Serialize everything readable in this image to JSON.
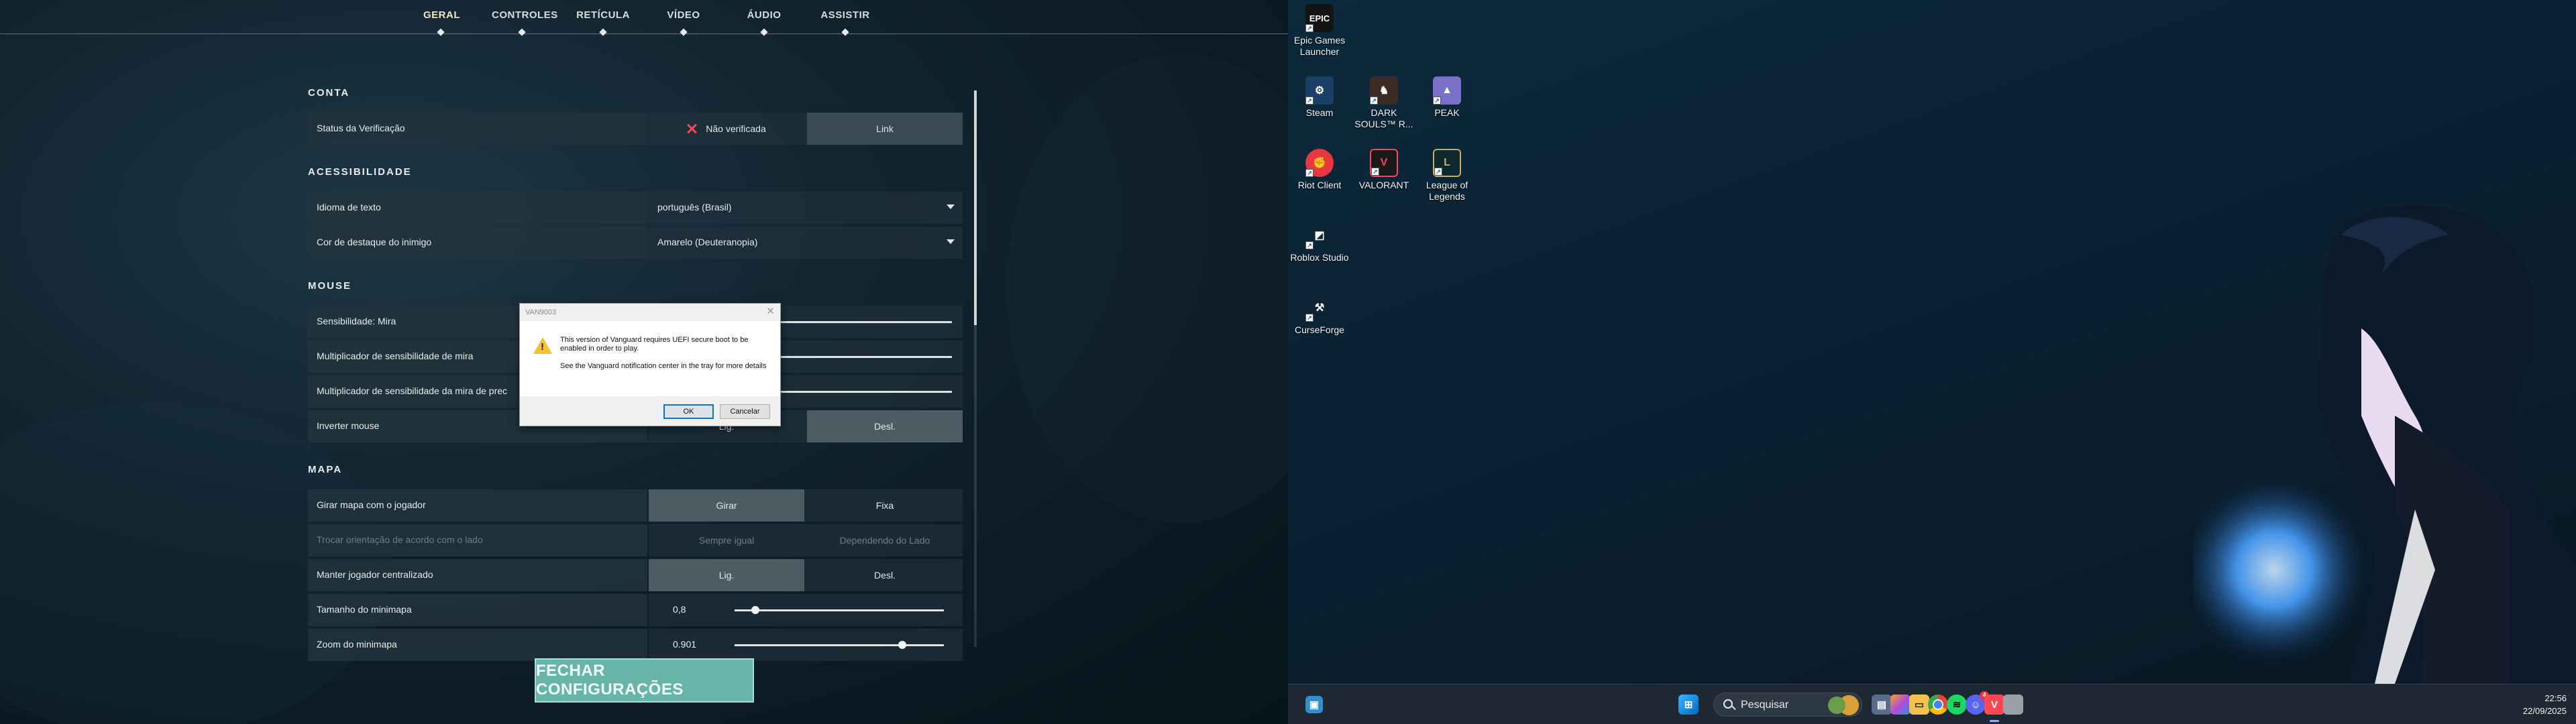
{
  "game_settings": {
    "tabs": [
      "GERAL",
      "CONTROLES",
      "RETÍCULA",
      "VÍDEO",
      "ÁUDIO",
      "ASSISTIR"
    ],
    "sections": {
      "conta": {
        "title": "CONTA",
        "verification_label": "Status da Verificação",
        "verification_status": "Não verificada",
        "link_label": "Link"
      },
      "acessibilidade": {
        "title": "ACESSIBILIDADE",
        "text_language_label": "Idioma de texto",
        "text_language_value": "português (Brasil)",
        "enemy_highlight_label": "Cor de destaque do inimigo",
        "enemy_highlight_value": "Amarelo (Deuteranopia)"
      },
      "mouse": {
        "title": "MOUSE",
        "sensitivity_label": "Sensibilidade: Mira",
        "aim_multiplier_label": "Multiplicador de sensibilidade de mira",
        "scope_multiplier_label": "Multiplicador de sensibilidade da mira de prec",
        "invert_label": "Inverter mouse",
        "on_label": "Lig.",
        "off_label": "Desl."
      },
      "mapa": {
        "title": "MAPA",
        "rotate_label": "Girar mapa com o jogador",
        "rotate_opt": "Girar",
        "fixed_opt": "Fixa",
        "orientation_label": "Trocar orientação de acordo com o lado",
        "always_same_opt": "Sempre igual",
        "depends_side_opt": "Dependendo do Lado",
        "center_label": "Manter jogador centralizado",
        "on_label": "Lig.",
        "off_label": "Desl.",
        "size_label": "Tamanho do minimapa",
        "size_value": "0,8",
        "size_fraction": 0.1,
        "zoom_label": "Zoom do minimapa",
        "zoom_value": "0.901",
        "zoom_fraction": 0.8
      }
    },
    "close_button": "FECHAR CONFIGURAÇÕES"
  },
  "dialog": {
    "title": "VAN9003",
    "message_1": "This version of Vanguard requires UEFI secure boot to be enabled in order to play.",
    "message_2": "See the Vanguard notification center in the tray for more details",
    "ok_label": "OK",
    "cancel_label": "Cancelar"
  },
  "desktop": {
    "icons": {
      "epic": "Epic Games Launcher",
      "steam": "Steam",
      "darksouls": "DARK SOULS™ R...",
      "peak": "PEAK",
      "riot": "Riot Client",
      "valorant": "VALORANT",
      "lol": "League of Legends",
      "roblox": "Roblox Studio",
      "curseforge": "CurseForge"
    },
    "epic_logo_text": "EPIC"
  },
  "taskbar": {
    "search_placeholder": "Pesquisar",
    "time": "22:56",
    "date": "22/09/2025",
    "discord_badge": "4"
  }
}
